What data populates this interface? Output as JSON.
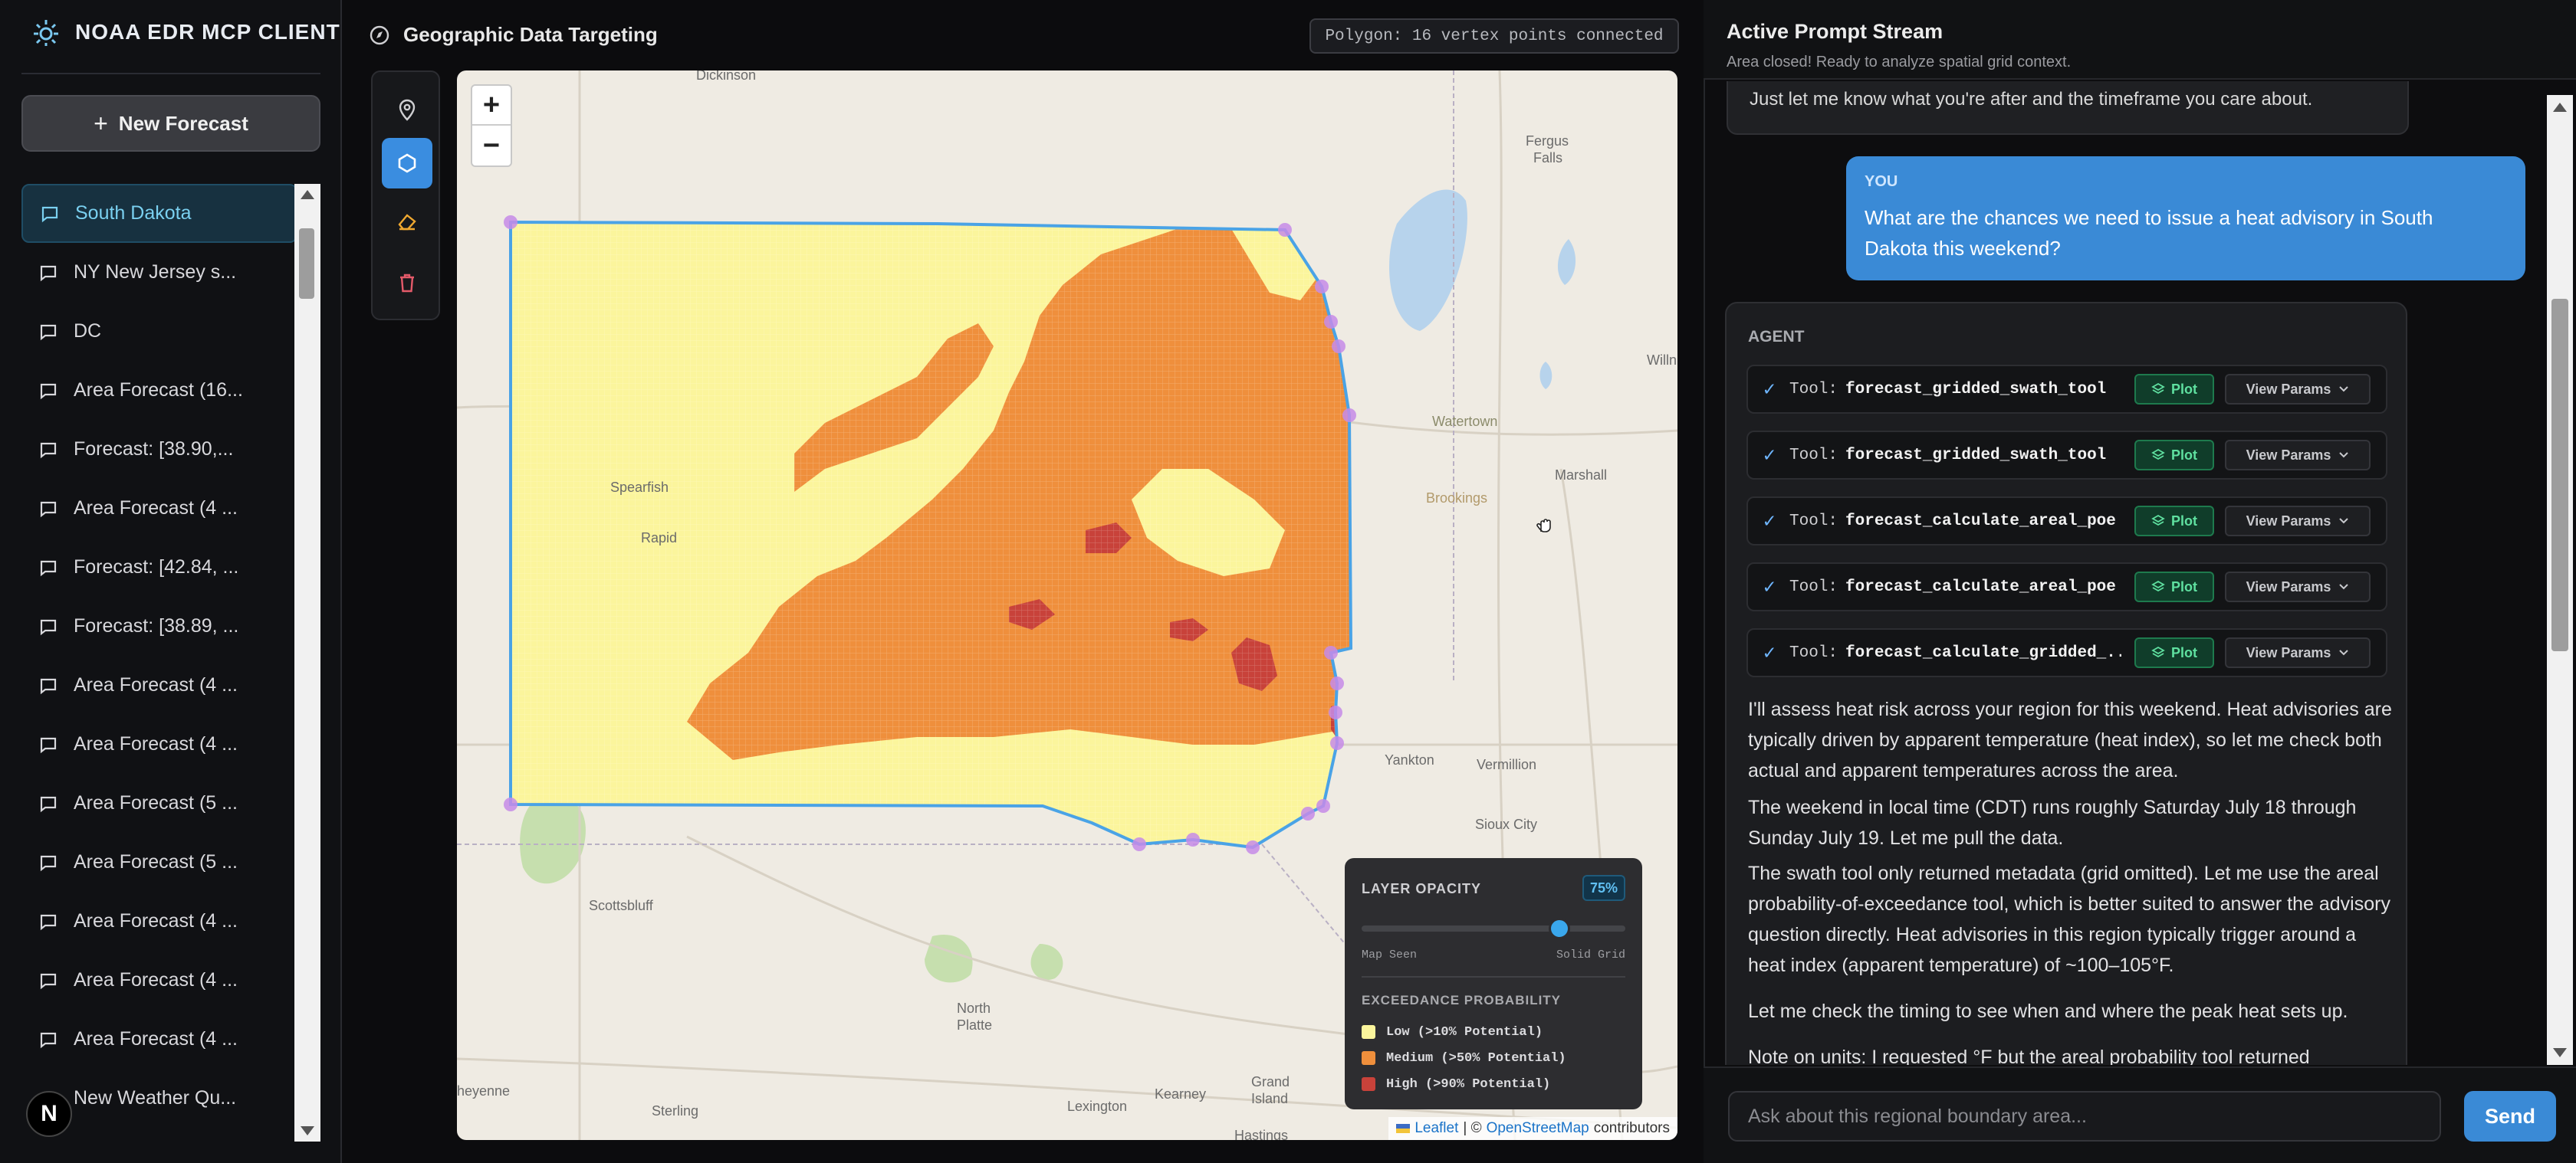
{
  "app": {
    "title": "NOAA EDR MCP CLIENT"
  },
  "sidebar": {
    "new_button": "New Forecast",
    "avatar_letter": "N",
    "items": [
      {
        "label": "South Dakota"
      },
      {
        "label": "NY New Jersey s..."
      },
      {
        "label": "DC"
      },
      {
        "label": "Area Forecast (16..."
      },
      {
        "label": "Forecast: [38.90,..."
      },
      {
        "label": "Area Forecast (4 ..."
      },
      {
        "label": "Forecast: [42.84, ..."
      },
      {
        "label": "Forecast: [38.89, ..."
      },
      {
        "label": "Area Forecast (4 ..."
      },
      {
        "label": "Area Forecast (4 ..."
      },
      {
        "label": "Area Forecast (5 ..."
      },
      {
        "label": "Area Forecast (5 ..."
      },
      {
        "label": "Area Forecast (4 ..."
      },
      {
        "label": "Area Forecast (4 ..."
      },
      {
        "label": "Area Forecast (4 ..."
      },
      {
        "label": "New Weather Qu..."
      }
    ]
  },
  "map": {
    "title": "Geographic Data Targeting",
    "polygon_status": "Polygon: 16 vertex points connected",
    "zoom_in": "+",
    "zoom_out": "−",
    "towns": {
      "dickinson": "Dickinson",
      "fergus": "Fergus",
      "falls": "Falls",
      "willmar": "Willn",
      "marshall": "Marshall",
      "spearfish": "Spearfish",
      "rapid": "Rapid",
      "watertown": "Watertown",
      "brookings": "Brookings",
      "yankton": "Yankton",
      "vermillion": "Vermillion",
      "sioux": "Sioux City",
      "scottsbluff": "Scottsbluff",
      "north": "North",
      "platte": "Platte",
      "cheyenne": "heyenne",
      "kearney": "Kearney",
      "grand": "Grand",
      "island": "Island",
      "lexington": "Lexington",
      "sterling": "Sterling",
      "hastings": "Hastings"
    },
    "attribution": {
      "leaflet": "Leaflet",
      "osm": "OpenStreetMap",
      "tail": "contributors",
      "sep": "| ©"
    },
    "legend": {
      "opacity_title": "LAYER OPACITY",
      "opacity_value": "75%",
      "opacity_level": 0.75,
      "left_label": "Map Seen",
      "right_label": "Solid Grid",
      "exceed_title": "EXCEEDANCE PROBABILITY",
      "items": [
        {
          "label": "Low (>10% Potential)",
          "color": "#fbf59c"
        },
        {
          "label": "Medium (>50% Potential)",
          "color": "#ef8f3c"
        },
        {
          "label": "High (>90% Potential)",
          "color": "#c8423a"
        }
      ]
    }
  },
  "stream": {
    "title": "Active Prompt Stream",
    "subtitle": "Area closed! Ready to analyze spatial grid context.",
    "prev_agent_text": "Just let me know what you're after and the timeframe you care about.",
    "user": {
      "label": "YOU",
      "text": "What are the chances we need to issue a heat advisory in South Dakota this weekend?"
    },
    "agent": {
      "label": "AGENT",
      "tool_prefix": "Tool:",
      "plot_label": "Plot",
      "params_label": "View Params",
      "tools": [
        {
          "name": "forecast_gridded_swath_tool"
        },
        {
          "name": "forecast_gridded_swath_tool"
        },
        {
          "name": "forecast_calculate_areal_poe"
        },
        {
          "name": "forecast_calculate_areal_poe"
        },
        {
          "name": "forecast_calculate_gridded_..."
        }
      ],
      "paragraphs": [
        "I'll assess heat risk across your region for this weekend. Heat advisories are typically driven by apparent temperature (heat index), so let me check both actual and apparent temperatures across the area.",
        "The weekend in local time (CDT) runs roughly Saturday July 18 through Sunday July 19. Let me pull the data.",
        "The swath tool only returned metadata (grid omitted). Let me use the areal probability-of-exceedance tool, which is better suited to answer the advisory question directly. Heat advisories in this region typically trigger around a heat index (apparent temperature) of ~100–105°F.",
        "Let me check the timing to see when and where the peak heat sets up.",
        "Note on units: I requested °F but the areal probability tool returned"
      ]
    },
    "input_placeholder": "Ask about this regional boundary area...",
    "send_label": "Send"
  },
  "colors": {
    "accent": "#3a8ad6",
    "polygon": "#4aa3e6",
    "vertex": "#c58be8",
    "low": "#fbf59c",
    "medium": "#ef8f3c",
    "high": "#c8423a"
  }
}
